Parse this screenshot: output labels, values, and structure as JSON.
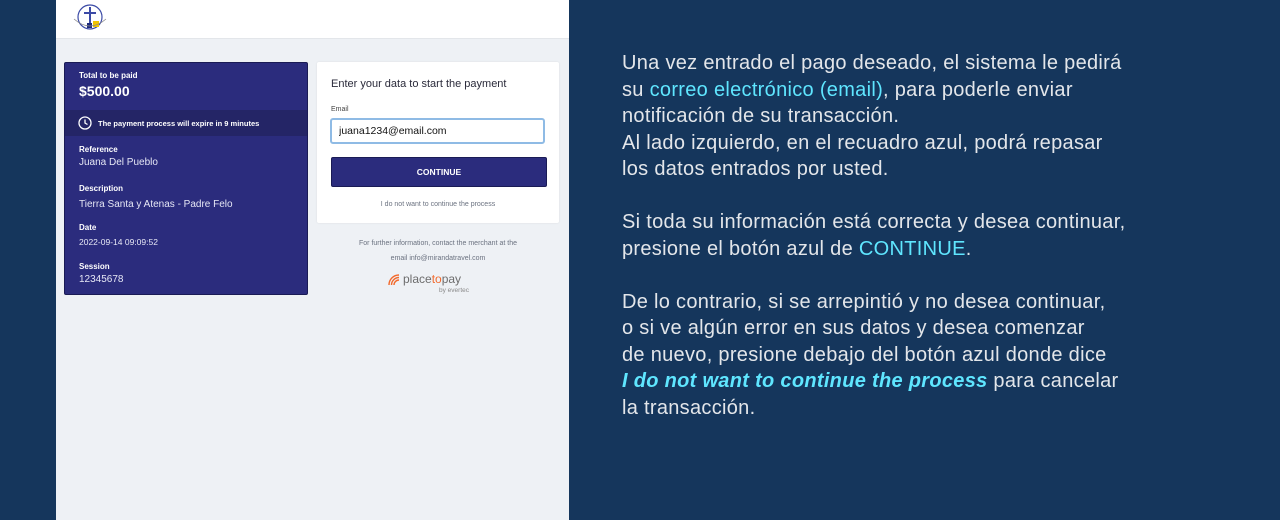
{
  "summary": {
    "total_label": "Total to be paid",
    "total_amount": "$500.00",
    "expire_text": "The payment process will expire in 9 minutes",
    "fields": [
      {
        "label": "Reference",
        "value": "Juana Del Pueblo"
      },
      {
        "label": "Description",
        "value": "Tierra Santa y Atenas - Padre Felo"
      },
      {
        "label": "Date",
        "value": "2022-09-14 09:09:52"
      },
      {
        "label": "Session",
        "value": "12345678"
      }
    ]
  },
  "form": {
    "title": "Enter your data to start the payment",
    "email_label": "Email",
    "email_value": "juana1234@email.com",
    "continue_label": "CONTINUE",
    "cancel_label": "I do not want to continue the process"
  },
  "footer": {
    "info_line1": "For further information, contact the merchant at the",
    "info_line2": "email info@mirandatravel.com",
    "brand_part1": "place",
    "brand_part2": "to",
    "brand_part3": "pay",
    "brand_sub": "by evertec"
  },
  "explanation": {
    "p1_a": "Una vez entrado el pago deseado, el sistema le pedirá",
    "p1_b": "su ",
    "p1_hl": "correo electrónico (email)",
    "p1_c": ", para poderle enviar",
    "p1_d": "notificación de su transacción.",
    "p1_e": "Al lado izquierdo, en el recuadro azul, podrá repasar",
    "p1_f": "los datos entrados por usted.",
    "p2_a": "Si toda su información está correcta y desea continuar,",
    "p2_b": "presione el botón azul de ",
    "p2_hl": "CONTINUE",
    "p2_c": ".",
    "p3_a": "De lo contrario, si se arrepintió y no desea continuar,",
    "p3_b": "o si ve algún error en sus datos y desea comenzar",
    "p3_c": "de nuevo, presione debajo del botón azul donde dice",
    "p3_hl": "I do not want to continue the process",
    "p3_d": " para cancelar",
    "p3_e": "la transacción."
  },
  "colors": {
    "background": "#15365c",
    "summary_card": "#2b2c7d",
    "highlight": "#5fe6ff",
    "brand_accent": "#f26a2d"
  }
}
